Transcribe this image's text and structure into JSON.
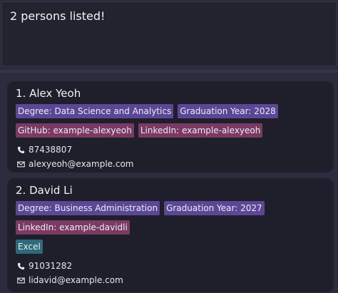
{
  "result": {
    "message": "2 persons listed!"
  },
  "persons": [
    {
      "name": "1. Alex Yeoh",
      "degree": "Degree: Data Science and Analytics",
      "graduation": "Graduation Year: 2028",
      "github": "GitHub: example-alexyeoh",
      "linkedin": "LinkedIn: example-alexyeoh",
      "phone": "87438807",
      "email": "alexyeoh@example.com"
    },
    {
      "name": "2. David Li",
      "degree": "Degree: Business Administration",
      "graduation": "Graduation Year: 2027",
      "linkedin": "LinkedIn: example-davidli",
      "skill": "Excel",
      "phone": "91031282",
      "email": "lidavid@example.com"
    }
  ],
  "icons": {
    "phone": "phone-icon",
    "email": "email-icon"
  },
  "colors": {
    "degree_tag": "#5b4795",
    "social_tag": "#7a3a63",
    "skill_tag": "#2e6a7a",
    "card_bg": "#1f1f2b",
    "app_bg": "#2b2b3c"
  }
}
